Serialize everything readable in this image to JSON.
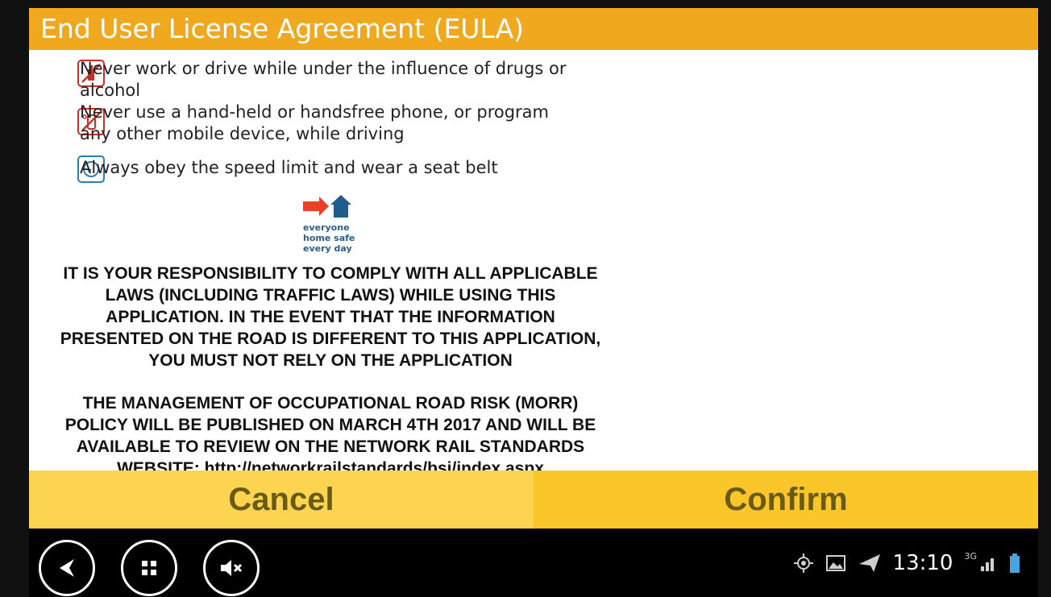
{
  "header": {
    "title": "End User License Agreement (EULA)"
  },
  "warnings": [
    {
      "icon": "no-alcohol-icon",
      "text": "Never work or drive while under the influence of drugs or alcohol"
    },
    {
      "icon": "no-phone-icon",
      "text": "Never use a hand-held or handsfree phone, or program any other mobile device, while driving"
    },
    {
      "icon": "speedometer-icon",
      "text": "Always obey the speed limit and wear a seat belt"
    }
  ],
  "logo": {
    "line1": "everyone",
    "line2": "home safe",
    "line3": "every day"
  },
  "legal": {
    "responsibility": [
      "IT IS YOUR RESPONSIBILITY TO COMPLY WITH ALL APPLICABLE",
      "LAWS (INCLUDING TRAFFIC LAWS) WHILE USING THIS",
      "APPLICATION. IN THE EVENT THAT THE INFORMATION",
      "PRESENTED ON THE ROAD IS DIFFERENT TO THIS APPLICATION,",
      "YOU MUST NOT RELY ON THE APPLICATION"
    ],
    "morr": [
      "THE MANAGEMENT OF OCCUPATIONAL ROAD RISK (MORR)",
      "POLICY WILL BE PUBLISHED ON MARCH 4TH 2017 AND WILL BE",
      "AVAILABLE TO REVIEW ON THE NETWORK RAIL STANDARDS",
      "WEBSITE: http://networkrailstandards/bsi/index.aspx"
    ]
  },
  "buttons": {
    "cancel": "Cancel",
    "confirm": "Confirm"
  },
  "statusbar": {
    "time": "13:10",
    "network": "3G"
  },
  "colors": {
    "header": "#f0a91f",
    "cancel_bg": "#fdd451",
    "confirm_bg": "#fbc62a",
    "button_text": "#6b5a14"
  }
}
